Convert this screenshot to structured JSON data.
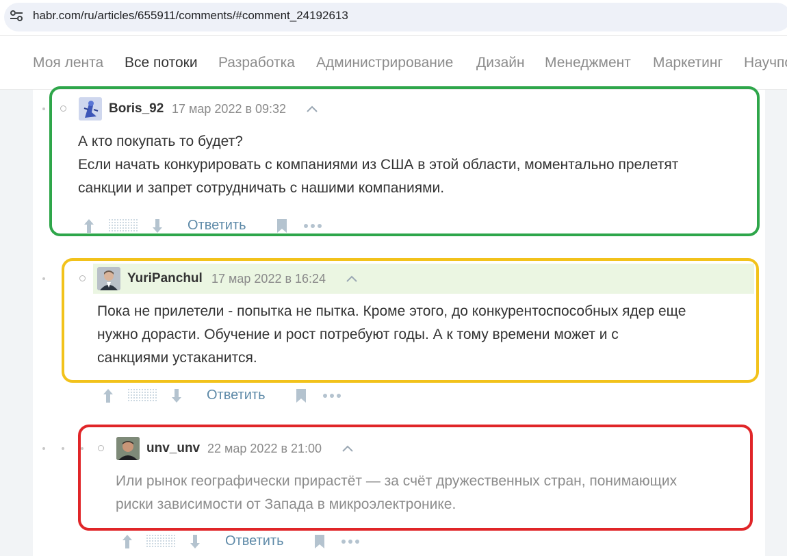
{
  "browser": {
    "url": "habr.com/ru/articles/655911/comments/#comment_24192613"
  },
  "nav": {
    "items": [
      {
        "label": "Моя лента",
        "active": false
      },
      {
        "label": "Все потоки",
        "active": true
      },
      {
        "label": "Разработка",
        "active": false
      },
      {
        "label": "Администрирование",
        "active": false
      },
      {
        "label": "Дизайн",
        "active": false
      },
      {
        "label": "Менеджмент",
        "active": false
      },
      {
        "label": "Маркетинг",
        "active": false
      },
      {
        "label": "Научпоп",
        "active": false
      }
    ]
  },
  "comments": [
    {
      "username": "Boris_92",
      "timestamp": "17 мар 2022 в 09:32",
      "avatar_icon": "robot-avatar",
      "lines": [
        "А кто покупать то будет?",
        "Если начать конкурировать с компаниями из США в этой области, моментально прелетят",
        "санкции и запрет сотрудничать с нашими компаниями."
      ],
      "reply_label": "Ответить",
      "highlight_color": "#2ea64a",
      "is_author": false
    },
    {
      "username": "YuriPanchul",
      "timestamp": "17 мар 2022 в 16:24",
      "avatar_icon": "person-photo-avatar",
      "lines": [
        "Пока не прилетели - попытка не пытка. Кроме этого, до конкурентоспособных ядер еще",
        "нужно дорасти. Обучение и рост потребуют годы. А к тому времени может и с",
        "санкциями устаканится."
      ],
      "reply_label": "Ответить",
      "highlight_color": "#f2c21b",
      "is_author": true
    },
    {
      "username": "unv_unv",
      "timestamp": "22 мар 2022 в 21:00",
      "avatar_icon": "person-photo-avatar",
      "lines": [
        "Или рынок географически прирастёт — за счёт дружественных стран, понимающих",
        "риски зависимости от Запада в микроэлектронике."
      ],
      "reply_label": "Ответить",
      "highlight_color": "#e02528",
      "muted": true
    }
  ]
}
